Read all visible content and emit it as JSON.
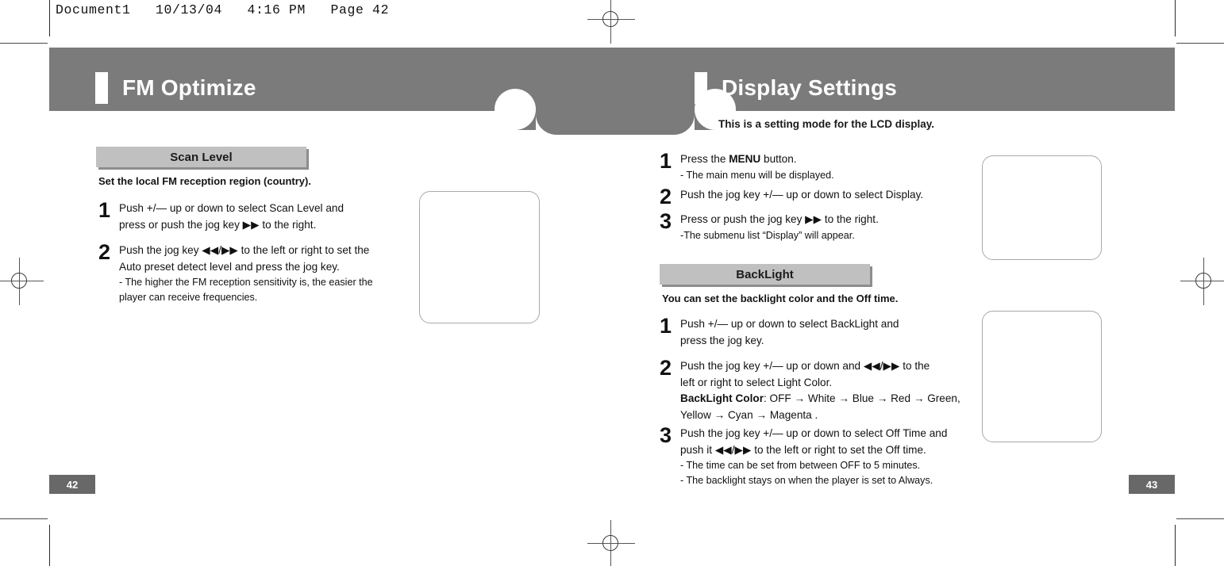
{
  "slug": {
    "text": "Document1   10/13/04   4:16 PM   Page 42"
  },
  "left_page": {
    "title": "FM Optimize",
    "section": {
      "title": "Scan Level",
      "intro": "Set the local FM reception region (country).",
      "steps": [
        {
          "number": "1",
          "lines": [
            "Push  +/—  up or down to select Scan Level and",
            "press or push the jog key  ▶▶  to the right."
          ]
        },
        {
          "number": "2",
          "lines": [
            "Push the jog key  ◀◀/▶▶  to the left or right to set the",
            "Auto preset detect level and press the jog key.",
            "- The higher the FM reception sensitivity is, the easier the",
            "player can receive frequencies."
          ]
        }
      ]
    },
    "page_number": "42"
  },
  "right_page": {
    "title": "Display Settings",
    "subtitle": "This is a setting mode for the LCD display.",
    "steps": [
      {
        "number": "1",
        "line_main_a": "Press the ",
        "line_main_bold": "MENU",
        "line_main_b": " button.",
        "note": "- The main menu will be displayed."
      },
      {
        "number": "2",
        "line_main_a": "Push the jog key  +/—  up or down to select Display.",
        "line_main_bold": "",
        "line_main_b": "",
        "note": ""
      },
      {
        "number": "3",
        "line_main_a": "Press or push the jog key  ▶▶  to the right.",
        "line_main_bold": "",
        "line_main_b": "",
        "note": "-The submenu list “Display” will appear."
      }
    ],
    "section": {
      "title": "BackLight",
      "intro": "You can set the backlight color and the Off time.",
      "steps": [
        {
          "number": "1",
          "lines": [
            "Push  +/—  up or down to select BackLight and",
            "press the jog key."
          ]
        },
        {
          "number": "2",
          "lines": [
            "Push the jog key  +/—  up or down and  ◀◀/▶▶  to the",
            "left or right to select Light Color."
          ],
          "color_label": "BackLight Color",
          "color_sequence": ": OFF → White → Blue → Red → Green,",
          "color_sequence_2": "Yellow → Cyan → Magenta      ."
        },
        {
          "number": "3",
          "lines": [
            "Push the jog key  +/—  up or down to select Off Time and",
            "push it  ◀◀/▶▶  to the left or right to set the Off time."
          ],
          "notes": [
            "- The time can be set from between OFF to 5 minutes.",
            "- The backlight stays on when the player is set to Always."
          ]
        }
      ]
    },
    "page_number": "43"
  },
  "colors": {
    "header_gray": "#7b7b7b",
    "section_gray": "#c0c0c0",
    "section_shadow": "#8d8d8d",
    "page_num_gray": "#686868",
    "art_border": "#a9a9a9"
  }
}
